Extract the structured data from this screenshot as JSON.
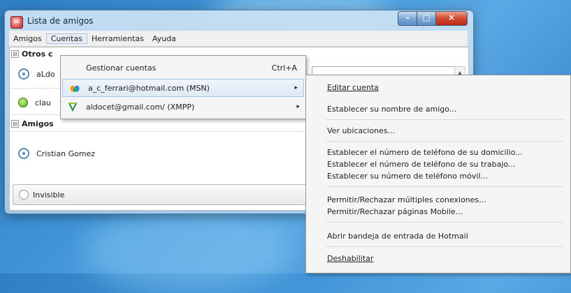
{
  "window": {
    "title": "Lista de amigos",
    "close_glyph": "×",
    "max_glyph": "□",
    "min_glyph": "–"
  },
  "menubar": {
    "items": [
      "Amigos",
      "Cuentas",
      "Herramientas",
      "Ayuda"
    ]
  },
  "groups": [
    {
      "name": "Otros c",
      "expander": "⊟"
    },
    {
      "name": "Amigos",
      "expander": "⊟"
    }
  ],
  "contacts": [
    {
      "name": "aLdo",
      "status": "invisible"
    },
    {
      "name": "clau",
      "status": "online"
    },
    {
      "name": "Cristian Gomez",
      "status": "invisible"
    }
  ],
  "status_selector": {
    "label": "Invisible"
  },
  "accounts_menu": {
    "items": [
      {
        "label": "Gestionar cuentas",
        "shortcut": "Ctrl+A"
      },
      {
        "label": "a_c_ferrari@hotmail.com (MSN)",
        "arrow": "▸",
        "icon": "msn-butterfly-icon"
      },
      {
        "label": "aldocet@gmail.com/ (XMPP)",
        "arrow": "▸",
        "icon": "xmpp-bulb-icon"
      }
    ]
  },
  "submenu": {
    "items": [
      "Editar cuenta",
      "Establecer su nombre de amigo...",
      "Ver ubicaciones...",
      "Establecer el número de teléfono de su domicilio...",
      "Establecer el número de teléfono de su trabajo...",
      "Establecer su número de teléfono móvil...",
      "Permitir/Rechazar múltiples conexiones...",
      "Permitir/Rechazar páginas Mobile...",
      "Abrir bandeja de entrada de Hotmail",
      "Deshabilitar"
    ]
  },
  "colors": {
    "desktop": "#3f93d6",
    "hover": "#dfe9f5",
    "close": "#d2482f"
  }
}
